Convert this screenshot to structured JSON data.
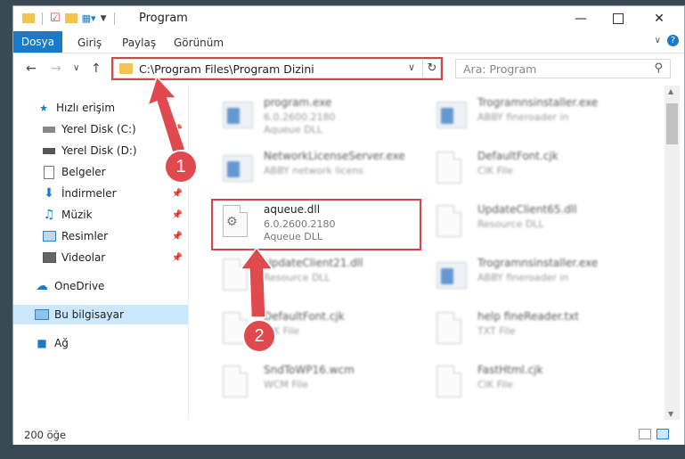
{
  "window": {
    "title": "Program"
  },
  "ribbon": {
    "tabs": [
      "Dosya",
      "Giriş",
      "Paylaş",
      "Görünüm"
    ]
  },
  "address": {
    "path": "C:\\Program Files\\Program Dizini"
  },
  "search": {
    "placeholder": "Ara: Program"
  },
  "sidebar": {
    "items": [
      {
        "label": "Hızlı erişim",
        "icon": "star-icon"
      },
      {
        "label": "Yerel Disk (C:)",
        "icon": "drive-icon"
      },
      {
        "label": "Yerel Disk (D:)",
        "icon": "drive-icon"
      },
      {
        "label": "Belgeler",
        "icon": "document-icon"
      },
      {
        "label": "İndirmeler",
        "icon": "download-icon"
      },
      {
        "label": "Müzik",
        "icon": "music-icon"
      },
      {
        "label": "Resimler",
        "icon": "picture-icon"
      },
      {
        "label": "Videolar",
        "icon": "video-icon"
      },
      {
        "label": "OneDrive",
        "icon": "cloud-icon"
      },
      {
        "label": "Bu bilgisayar",
        "icon": "computer-icon"
      },
      {
        "label": "Ağ",
        "icon": "network-icon"
      }
    ]
  },
  "files": [
    {
      "name": "program.exe",
      "l2": "6.0.2600.2180",
      "l3": "Aqueue DLL",
      "kind": "app"
    },
    {
      "name": "Trogramnsinstaller.exe",
      "l2": "ABBY fineroader in",
      "l3": "",
      "kind": "app"
    },
    {
      "name": "NetworkLicenseServer.exe",
      "l2": "ABBY network licens",
      "l3": "",
      "kind": "app"
    },
    {
      "name": "DefaultFont.cjk",
      "l2": "CIK File",
      "l3": "",
      "kind": "doc"
    },
    {
      "name": "aqueue.dll",
      "l2": "6.0.2600.2180",
      "l3": "Aqueue DLL",
      "kind": "dll"
    },
    {
      "name": "UpdateClient65.dll",
      "l2": "Resource DLL",
      "l3": "",
      "kind": "dll"
    },
    {
      "name": "UpdateClient21.dll",
      "l2": "Resource DLL",
      "l3": "",
      "kind": "dll"
    },
    {
      "name": "Trogramnsinstaller.exe",
      "l2": "ABBY fineroader in",
      "l3": "",
      "kind": "app"
    },
    {
      "name": "DefaultFont.cjk",
      "l2": "CIK File",
      "l3": "",
      "kind": "doc"
    },
    {
      "name": "help fineReader.txt",
      "l2": "TXT File",
      "l3": "",
      "kind": "doc"
    },
    {
      "name": "SndToWP16.wcm",
      "l2": "WCM File",
      "l3": "",
      "kind": "doc"
    },
    {
      "name": "FastHtml.cjk",
      "l2": "CIK File",
      "l3": "",
      "kind": "doc"
    }
  ],
  "status": {
    "count": "200 öğe"
  },
  "annotations": {
    "step1": "1",
    "step2": "2"
  },
  "colors": {
    "accent": "#1979ca",
    "highlight": "#d9434a",
    "selected": "#cce8ff"
  }
}
